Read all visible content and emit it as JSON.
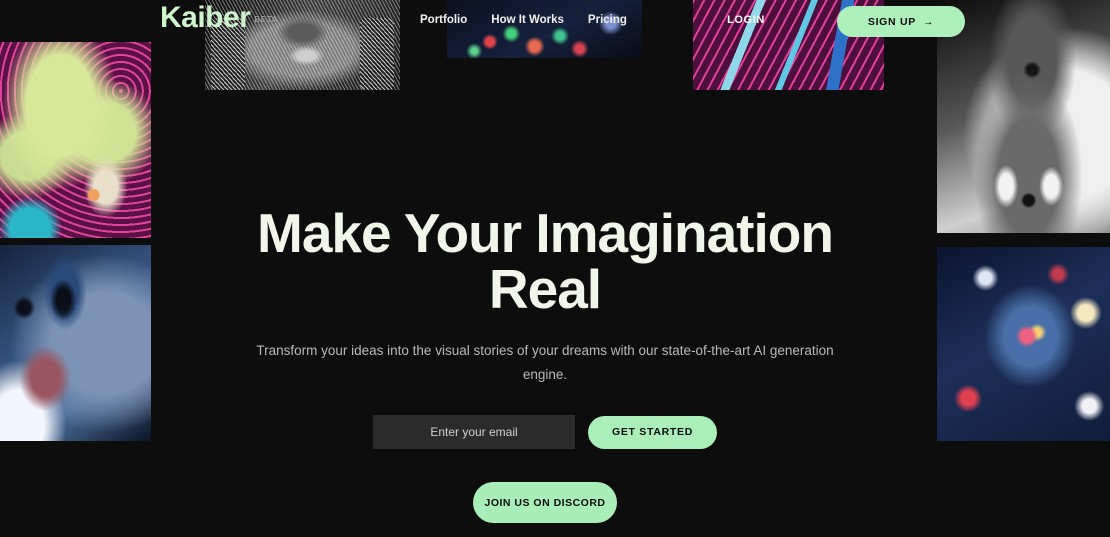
{
  "brand": {
    "logo": "Kaiber",
    "badge": "BETA"
  },
  "nav": {
    "items": [
      {
        "label": "Portfolio"
      },
      {
        "label": "How It Works"
      },
      {
        "label": "Pricing"
      }
    ]
  },
  "header": {
    "login_label": "LOGIN",
    "signup_label": "SIGN UP",
    "signup_arrow": "→"
  },
  "hero": {
    "heading": "Make Your Imagination Real",
    "subheading": "Transform your ideas into the visual stories of your dreams with our state-of-the-art AI generation engine.",
    "email_placeholder": "Enter your email",
    "email_value": "",
    "get_started_label": "GET STARTED",
    "discord_label": "JOIN US ON DISCORD"
  },
  "artwork": {
    "cloud": "psychedelic-astronaut-clouds",
    "portrait": "blue-lit-woman-portrait",
    "face": "monochrome-face-earrings",
    "bokeh": "dark-bokeh-particles",
    "waves": "magenta-cyan-waves",
    "fox": "monochrome-foxes-in-mist",
    "cosmic": "cosmic-blue-abstract"
  },
  "colors": {
    "background": "#0d0d0d",
    "accent_green": "#aaeeb9",
    "logo_green": "#cdf4cd",
    "heading": "#f2f5e9",
    "body_text": "#b9b9b9",
    "input_bg": "#2b2b2b"
  }
}
